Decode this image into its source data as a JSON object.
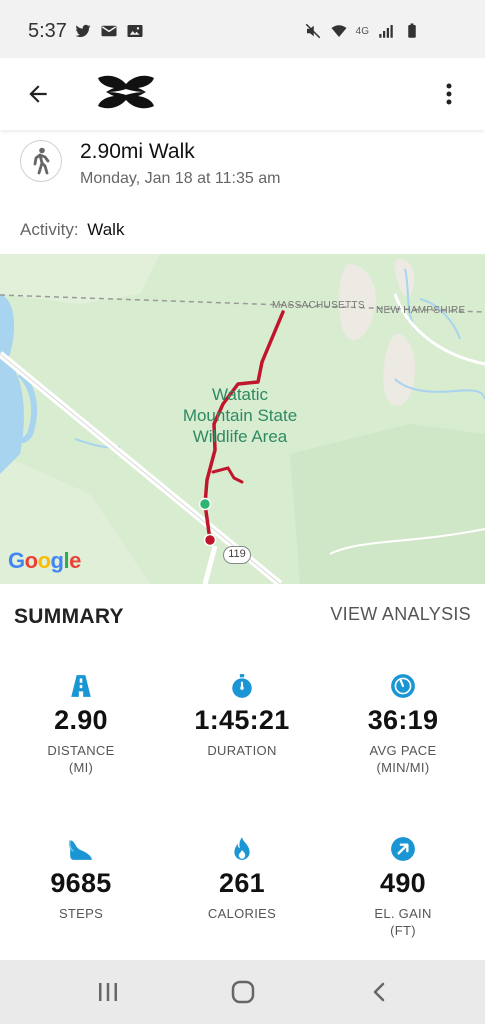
{
  "status_bar": {
    "time": "5:37",
    "left_icons": [
      "twitter-icon",
      "gmail-icon",
      "image-icon"
    ],
    "right_icons": [
      "mute-icon",
      "wifi-icon",
      "signal-icon",
      "battery-icon"
    ],
    "network": "4G"
  },
  "app_bar": {
    "back_icon": "arrow-back-icon",
    "logo": "under-armour-logo",
    "more_icon": "more-vert-icon"
  },
  "workout": {
    "icon": "walking-person-icon",
    "title": "2.90mi Walk",
    "date": "Monday, Jan 18 at 11:35 am",
    "activity_label": "Activity:",
    "activity_value": "Walk"
  },
  "map": {
    "area_label_line1": "Watatic",
    "area_label_line2": "Mountain State",
    "area_label_line3": "Wildlife Area",
    "state_left": "MASSACHUSETTS",
    "state_right": "NEW HAMPSHIRE",
    "route_number": "119",
    "attribution": "Google",
    "colors": {
      "land": "#d8ecd0",
      "route": "#c0162c",
      "water": "#a8d4f0",
      "start": "#2bb673",
      "end": "#c0162c"
    }
  },
  "summary": {
    "title": "SUMMARY",
    "view_analysis": "VIEW ANALYSIS",
    "accent_color": "#1a96d4",
    "stats": [
      {
        "icon": "road-icon",
        "value": "2.90",
        "label1": "DISTANCE",
        "label2": "(MI)"
      },
      {
        "icon": "stopwatch-icon",
        "value": "1:45:21",
        "label1": "DURATION",
        "label2": ""
      },
      {
        "icon": "speedometer-icon",
        "value": "36:19",
        "label1": "AVG PACE",
        "label2": "(MIN/MI)"
      },
      {
        "icon": "shoe-icon",
        "value": "9685",
        "label1": "STEPS",
        "label2": ""
      },
      {
        "icon": "flame-icon",
        "value": "261",
        "label1": "CALORIES",
        "label2": ""
      },
      {
        "icon": "elevation-arrow-icon",
        "value": "490",
        "label1": "EL. GAIN",
        "label2": "(FT)"
      }
    ]
  },
  "nav_bar": {
    "recents_icon": "recents-icon",
    "home_icon": "home-icon",
    "back_icon": "nav-back-icon"
  }
}
